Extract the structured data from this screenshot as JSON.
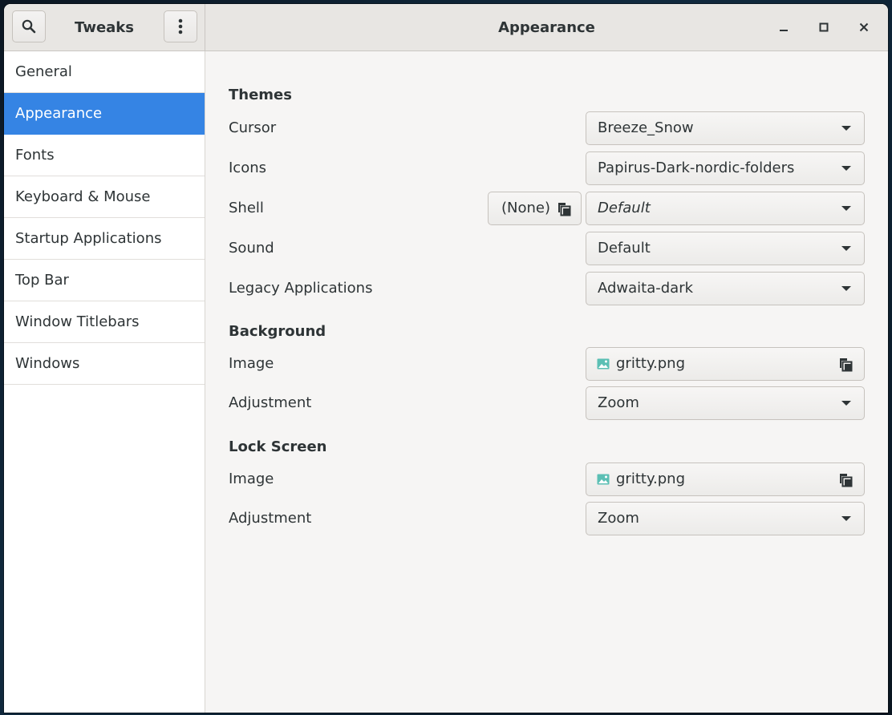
{
  "header": {
    "app_title": "Tweaks",
    "page_title": "Appearance"
  },
  "sidebar": {
    "items": [
      {
        "label": "General"
      },
      {
        "label": "Appearance"
      },
      {
        "label": "Fonts"
      },
      {
        "label": "Keyboard & Mouse"
      },
      {
        "label": "Startup Applications"
      },
      {
        "label": "Top Bar"
      },
      {
        "label": "Window Titlebars"
      },
      {
        "label": "Windows"
      }
    ],
    "active": "Appearance"
  },
  "themes": {
    "title": "Themes",
    "cursor": {
      "label": "Cursor",
      "value": "Breeze_Snow"
    },
    "icons": {
      "label": "Icons",
      "value": "Papirus-Dark-nordic-folders"
    },
    "shell": {
      "label": "Shell",
      "button_label": "(None)",
      "value": "Default"
    },
    "sound": {
      "label": "Sound",
      "value": "Default"
    },
    "legacy": {
      "label": "Legacy Applications",
      "value": "Adwaita-dark"
    }
  },
  "background": {
    "title": "Background",
    "image": {
      "label": "Image",
      "value": "gritty.png"
    },
    "adjustment": {
      "label": "Adjustment",
      "value": "Zoom"
    }
  },
  "lock_screen": {
    "title": "Lock Screen",
    "image": {
      "label": "Image",
      "value": "gritty.png"
    },
    "adjustment": {
      "label": "Adjustment",
      "value": "Zoom"
    }
  },
  "colors": {
    "accent": "#3584e4",
    "image_icon": "#5bbfb4"
  },
  "icons": [
    "search-icon",
    "kebab-menu-icon",
    "minimize-icon",
    "maximize-icon",
    "close-icon",
    "chevron-down-icon",
    "image-file-icon",
    "copy-icon"
  ]
}
